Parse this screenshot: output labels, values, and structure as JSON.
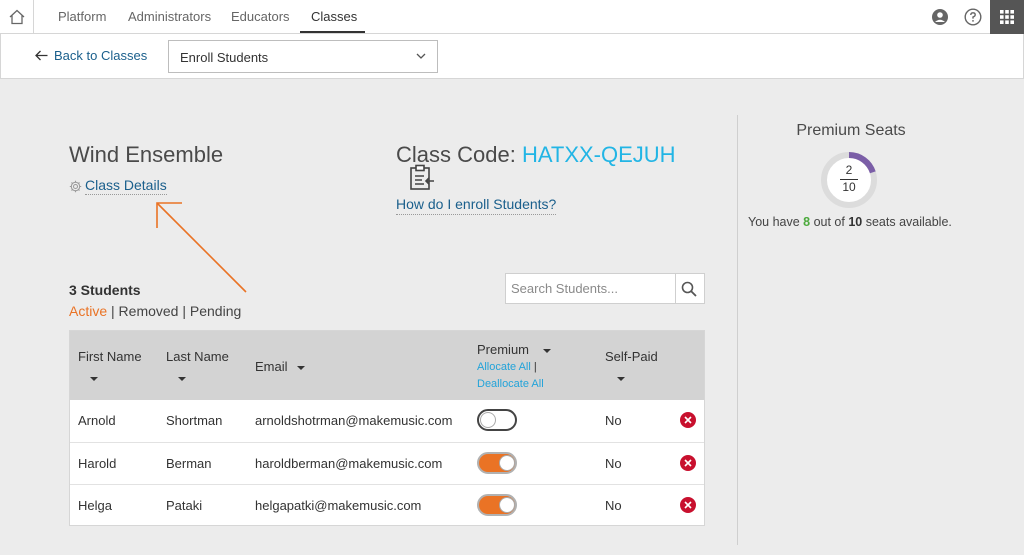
{
  "nav": {
    "tabs": [
      {
        "label": "Platform"
      },
      {
        "label": "Administrators"
      },
      {
        "label": "Educators"
      },
      {
        "label": "Classes"
      }
    ],
    "active_tab": "Classes"
  },
  "subbar": {
    "back_label": "Back to Classes",
    "select_value": "Enroll Students"
  },
  "class_info": {
    "name": "Wind Ensemble",
    "details_label": "Class Details",
    "code_label": "Class Code: ",
    "code_value": "HATXX-QEJUH",
    "enroll_help": "How do I enroll Students?"
  },
  "students": {
    "count_label": "3 Students",
    "filters": {
      "active": "Active",
      "sep": " | ",
      "removed": "Removed",
      "pending": "Pending"
    },
    "search_placeholder": "Search Students..."
  },
  "table": {
    "headers": {
      "first_name": "First Name",
      "last_name": "Last Name",
      "email": "Email",
      "premium": "Premium",
      "allocate_all": "Allocate All",
      "deallocate_all": "Deallocate All",
      "self_paid": "Self-Paid"
    },
    "rows": [
      {
        "first": "Arnold",
        "last": "Shortman",
        "email": "arnoldshotrman@makemusic.com",
        "premium": false,
        "self_paid": "No"
      },
      {
        "first": "Harold",
        "last": "Berman",
        "email": "haroldberman@makemusic.com",
        "premium": true,
        "self_paid": "No"
      },
      {
        "first": "Helga",
        "last": "Pataki",
        "email": "helgapatki@makemusic.com",
        "premium": true,
        "self_paid": "No"
      }
    ]
  },
  "seats": {
    "title": "Premium Seats",
    "used": "2",
    "total": "10",
    "text_prefix": "You have ",
    "available": "8",
    "text_mid": " out of ",
    "text_suffix": " seats available.",
    "used_fraction": 0.2
  },
  "colors": {
    "accent_orange": "#ea7325",
    "link_blue": "#1a5f8c",
    "code_cyan": "#22b5e5",
    "donut_purple": "#7b5ea7",
    "remove_red": "#c8102e"
  }
}
